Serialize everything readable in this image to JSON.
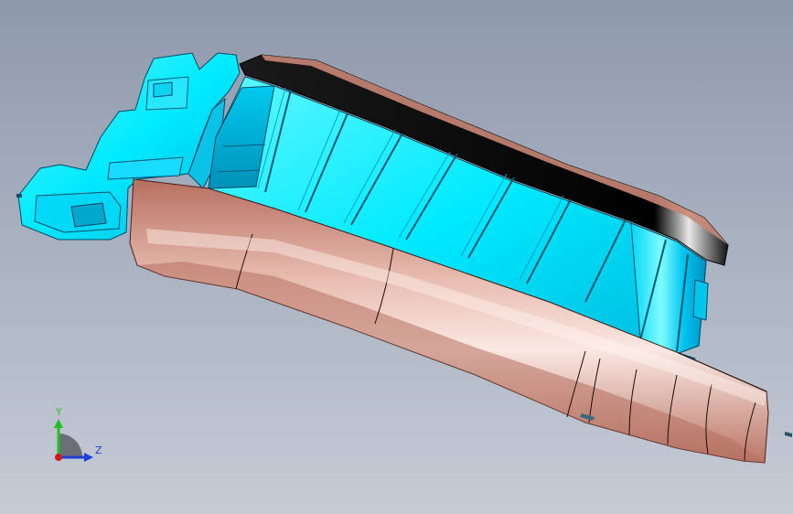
{
  "viewport": {
    "background_top": "#8e99ac",
    "background_bottom": "#c6ccd6",
    "model_colors": {
      "ribs": "#00f0ff",
      "ribs_dark": "#00a6c8",
      "shell": "#c98676",
      "shell_highlight": "#f4d6cc",
      "rim": "#0a0a0a"
    }
  },
  "triad": {
    "y_label": "Y",
    "z_label": "Z",
    "y_color": "#1fbf2a",
    "z_color": "#1f3fd6",
    "x_color": "#d01818"
  }
}
